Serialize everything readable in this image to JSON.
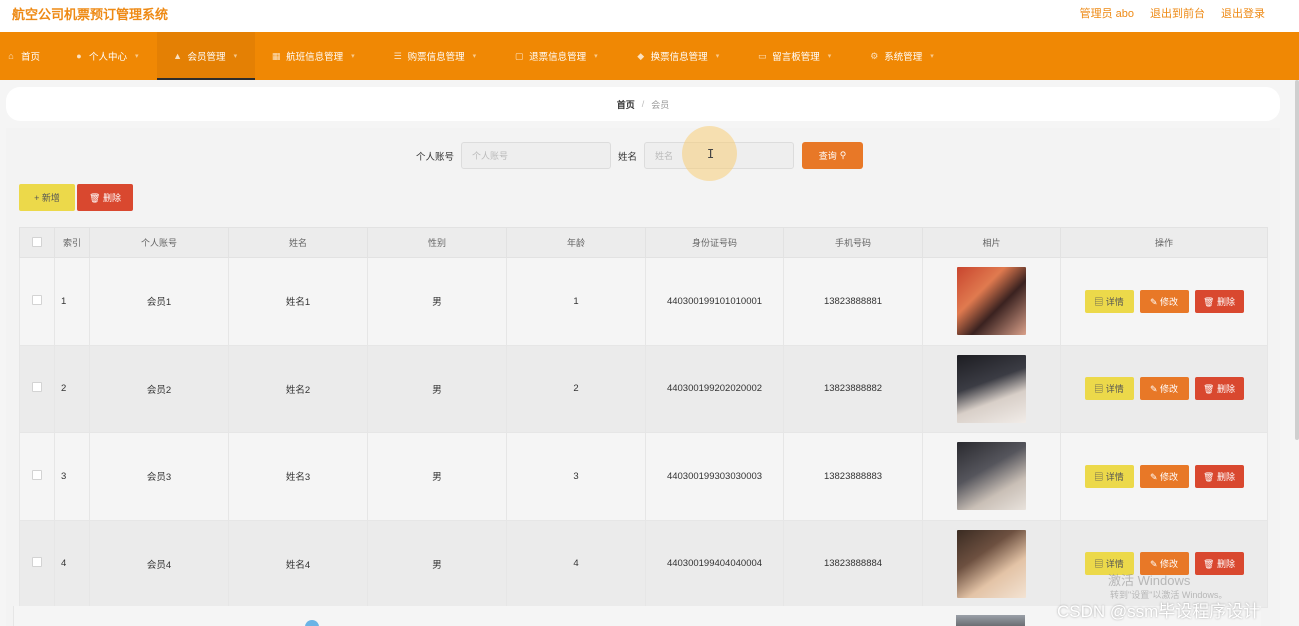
{
  "app": {
    "title": "航空公司机票预订管理系统",
    "links": {
      "admin": "管理员 abo",
      "front": "退出到前台",
      "logout": "退出登录"
    }
  },
  "nav": {
    "items": [
      {
        "label": "首页",
        "icon": "home-icon",
        "glyph": "⌂"
      },
      {
        "label": "个人中心",
        "icon": "user-icon",
        "glyph": "●"
      },
      {
        "label": "会员管理",
        "icon": "member-icon",
        "glyph": "▲"
      },
      {
        "label": "航班信息管理",
        "icon": "grid-icon",
        "glyph": "▦"
      },
      {
        "label": "购票信息管理",
        "icon": "list-icon",
        "glyph": "☰"
      },
      {
        "label": "退票信息管理",
        "icon": "doc-icon",
        "glyph": "▢"
      },
      {
        "label": "换票信息管理",
        "icon": "pin-icon",
        "glyph": "◆"
      },
      {
        "label": "留言板管理",
        "icon": "message-icon",
        "glyph": "▭"
      },
      {
        "label": "系统管理",
        "icon": "gear-icon",
        "glyph": "⚙"
      }
    ],
    "active_index": 2
  },
  "breadcrumb": {
    "home": "首页",
    "separator": "/",
    "current": "会员"
  },
  "search": {
    "account_label": "个人账号",
    "account_placeholder": "个人账号",
    "name_label": "姓名",
    "name_placeholder": "姓名",
    "query_label": "查询"
  },
  "actions": {
    "add_label": "+ 新增",
    "delete_label": "🗑 删除"
  },
  "table": {
    "headers": [
      "索引",
      "个人账号",
      "姓名",
      "性别",
      "年龄",
      "身份证号码",
      "手机号码",
      "相片",
      "操作"
    ],
    "rows": [
      {
        "index": "1",
        "account": "会员1",
        "name": "姓名1",
        "gender": "男",
        "age": "1",
        "id_number": "440300199101010001",
        "phone": "13823888881"
      },
      {
        "index": "2",
        "account": "会员2",
        "name": "姓名2",
        "gender": "男",
        "age": "2",
        "id_number": "440300199202020002",
        "phone": "13823888882"
      },
      {
        "index": "3",
        "account": "会员3",
        "name": "姓名3",
        "gender": "男",
        "age": "3",
        "id_number": "440300199303030003",
        "phone": "13823888883"
      },
      {
        "index": "4",
        "account": "会员4",
        "name": "姓名4",
        "gender": "男",
        "age": "4",
        "id_number": "440300199404040004",
        "phone": "13823888884"
      }
    ],
    "row_ops": {
      "detail": "▤ 详情",
      "edit": "✎ 修改",
      "delete": "🗑 删除"
    }
  },
  "watermarks": {
    "windows_line1": "激活 Windows",
    "windows_line2": "转到\"设置\"以激活 Windows。",
    "csdn": "CSDN @ssm毕设程序设计"
  },
  "colors": {
    "accent": "#f08804",
    "title": "#ee8a15",
    "query": "#e87827",
    "danger": "#d9482f",
    "warning": "#ecd94a"
  }
}
